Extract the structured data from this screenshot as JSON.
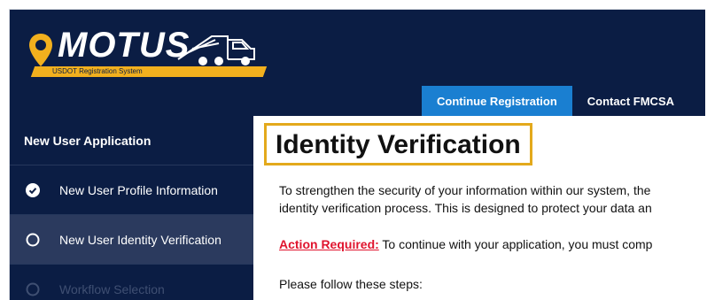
{
  "brand": {
    "name": "MOTUS",
    "subtitle": "USDOT Registration System",
    "accent": "#f2b01e",
    "background": "#0b1d44"
  },
  "nav": {
    "tabs": [
      {
        "label": "Continue Registration",
        "active": true
      },
      {
        "label": "Contact FMCSA",
        "active": false
      }
    ]
  },
  "sidebar": {
    "heading": "New User Application",
    "items": [
      {
        "label": "New User Profile Information",
        "state": "completed",
        "icon": "check-circle-icon"
      },
      {
        "label": "New User Identity Verification",
        "state": "current",
        "icon": "circle-outline-icon"
      },
      {
        "label": "Workflow Selection",
        "state": "disabled",
        "icon": "circle-outline-icon"
      }
    ]
  },
  "main": {
    "title": "Identity Verification",
    "intro_line1": "To strengthen the security of your information within our system, the",
    "intro_line2": "identity verification process. This is designed to protect your data an",
    "action_label": "Action Required:",
    "action_text": " To continue with your application, you must comp",
    "steps_intro": "Please follow these steps:"
  }
}
